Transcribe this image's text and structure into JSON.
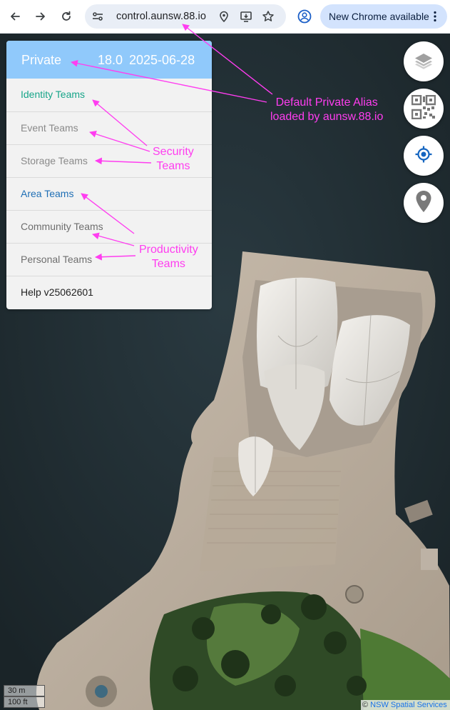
{
  "browser": {
    "url": "control.aunsw.88.io",
    "update_button_label": "New Chrome available",
    "icons": [
      "back-arrow-icon",
      "forward-arrow-icon",
      "reload-icon",
      "site-settings-icon",
      "location-pin-icon",
      "install-app-icon",
      "bookmark-star-icon",
      "profile-icon",
      "more-vert-icon"
    ]
  },
  "menu": {
    "header": {
      "title": "Private",
      "version": "18.0",
      "date": "2025-06-28"
    },
    "items": [
      {
        "label_a": "Identity",
        "label_b": "Teams",
        "color": "#17a589"
      },
      {
        "label": "Event Teams",
        "color": "#8a8a8a"
      },
      {
        "label": "Storage Teams",
        "color": "#8a8a8a"
      },
      {
        "label": "Area Teams",
        "color": "#1f6fb5"
      },
      {
        "label": "Community Teams",
        "color": "#6e6e6e"
      },
      {
        "label": "Personal Teams",
        "color": "#6e6e6e"
      },
      {
        "label": "Help v25062601",
        "color": "#222222"
      }
    ]
  },
  "map_controls": [
    "layers-icon",
    "qr-code-icon",
    "my-location-icon",
    "place-marker-icon"
  ],
  "annotations": {
    "alias": [
      "Default Private Alias",
      "loaded by aunsw.88.io"
    ],
    "security": [
      "Security",
      "Teams"
    ],
    "productivity": [
      "Productivity",
      "Teams"
    ],
    "color": "#ff3df0"
  },
  "scale": {
    "metric": "30 m",
    "imperial": "100 ft"
  },
  "attribution": {
    "prefix": "©",
    "link": "NSW Spatial Services"
  }
}
